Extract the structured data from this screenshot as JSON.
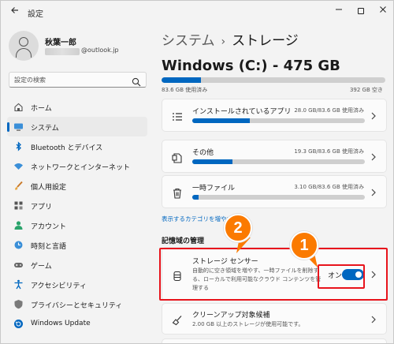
{
  "window": {
    "app_title": "設定",
    "back_icon": "back-arrow-icon",
    "min_icon": "minimize-icon",
    "max_icon": "maximize-icon",
    "close_icon": "close-icon"
  },
  "profile": {
    "name": "秋葉一郎",
    "email_suffix": "@outlook.jp"
  },
  "search": {
    "placeholder": "設定の検索",
    "icon": "search-icon"
  },
  "sidebar": {
    "items": [
      {
        "label": "ホーム",
        "icon": "home-icon",
        "active": false
      },
      {
        "label": "システム",
        "icon": "system-icon",
        "active": true
      },
      {
        "label": "Bluetooth とデバイス",
        "icon": "bluetooth-icon",
        "active": false
      },
      {
        "label": "ネットワークとインターネット",
        "icon": "network-icon",
        "active": false
      },
      {
        "label": "個人用設定",
        "icon": "personalization-icon",
        "active": false
      },
      {
        "label": "アプリ",
        "icon": "apps-icon",
        "active": false
      },
      {
        "label": "アカウント",
        "icon": "account-icon",
        "active": false
      },
      {
        "label": "時刻と言語",
        "icon": "time-language-icon",
        "active": false
      },
      {
        "label": "ゲーム",
        "icon": "gaming-icon",
        "active": false
      },
      {
        "label": "アクセシビリティ",
        "icon": "accessibility-icon",
        "active": false
      },
      {
        "label": "プライバシーとセキュリティ",
        "icon": "privacy-shield-icon",
        "active": false
      },
      {
        "label": "Windows Update",
        "icon": "windows-update-icon",
        "active": false
      }
    ]
  },
  "main": {
    "breadcrumb_parent": "システム",
    "breadcrumb_sep": "›",
    "breadcrumb_current": "ストレージ",
    "drive_title": "Windows (C:) - 475 GB",
    "drive_used_label": "83.6 GB 使用済み",
    "drive_total_label": "392 GB 空き",
    "drive_used_fraction": 0.176,
    "categories": [
      {
        "label": "インストールされているアプリ",
        "size": "28.0 GB/83.6 GB 使用済み",
        "fraction": 0.335,
        "icon": "apps-list-icon"
      },
      {
        "label": "その他",
        "size": "19.3 GB/83.6 GB 使用済み",
        "fraction": 0.231,
        "icon": "other-files-icon"
      },
      {
        "label": "一時ファイル",
        "size": "3.10 GB/83.6 GB 使用済み",
        "fraction": 0.037,
        "icon": "trash-icon"
      }
    ],
    "more_categories_link": "表示するカテゴリを増やす",
    "section_title": "記憶域の管理",
    "storage_sense": {
      "title": "ストレージ センサー",
      "desc": "自動的に空き領域を増やす、一時ファイルを削除する、ローカルで利用可能なクラウド コンテンツを管理する",
      "toggle_label": "オン",
      "toggle_on": true,
      "icon": "storage-drive-icon"
    },
    "cleanup": {
      "title": "クリーンアップ対象候補",
      "desc": "2.00 GB 以上のストレージが使用可能です。",
      "icon": "broom-icon"
    }
  },
  "annotations": {
    "badge_1": "1",
    "badge_2": "2",
    "accent_red": "#e8141c",
    "badge_orange": "#fb7a00"
  },
  "colors": {
    "accent": "#0067c0",
    "background": "#f3f3f3",
    "card": "#fbfbfb"
  }
}
